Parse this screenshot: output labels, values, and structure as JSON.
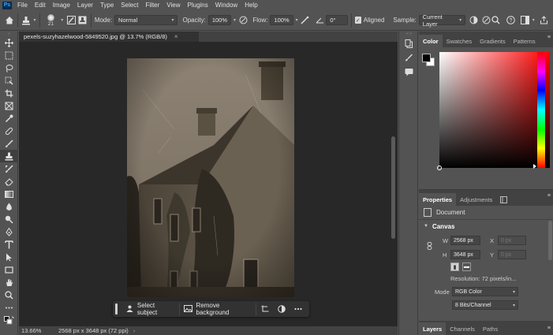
{
  "menu": [
    "File",
    "Edit",
    "Image",
    "Layer",
    "Type",
    "Select",
    "Filter",
    "View",
    "Plugins",
    "Window",
    "Help"
  ],
  "app_logo": "Ps",
  "options": {
    "brush_size": "21",
    "mode_label": "Mode:",
    "mode_value": "Normal",
    "opacity_label": "Opacity:",
    "opacity_value": "100%",
    "flow_label": "Flow:",
    "flow_value": "100%",
    "angle_value": "0°",
    "aligned_label": "Aligned",
    "sample_label": "Sample:",
    "sample_value": "Current Layer"
  },
  "document": {
    "tab_title": "pexels-suzyhazelwood-5849520.jpg @ 13.7% (RGB/8)",
    "zoom": "13.66%",
    "size_info": "2568 px x 3648 px (72 ppi)"
  },
  "context_bar": {
    "select_subject": "Select subject",
    "remove_background": "Remove background"
  },
  "color_panel": {
    "tabs": [
      "Color",
      "Swatches",
      "Gradients",
      "Patterns"
    ],
    "foreground": "#000000",
    "background": "#ffffff",
    "hue": "#ff0000"
  },
  "properties": {
    "tabs": [
      "Properties",
      "Adjustments"
    ],
    "doc_label": "Document",
    "canvas_label": "Canvas",
    "w_label": "W",
    "w_value": "2568 px",
    "x_label": "X",
    "x_value": "0 px",
    "h_label": "H",
    "h_value": "3648 px",
    "y_label": "Y",
    "y_value": "0 px",
    "resolution": "Resolution: 72 pixels/in...",
    "mode_label": "Mode",
    "mode_value": "RGB Color",
    "depth_value": "8 Bits/Channel"
  },
  "layers_tabs": [
    "Layers",
    "Channels",
    "Paths"
  ]
}
